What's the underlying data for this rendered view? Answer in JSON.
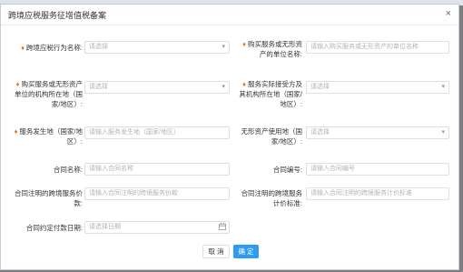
{
  "dialog": {
    "title": "跨境应税服务征增值税备案",
    "close_glyph": "×"
  },
  "fields": {
    "taxable_country": {
      "label": "跨境应税行为名称:",
      "placeholder": "请选择"
    },
    "purchaser_unit": {
      "label": "购买服务或无形资产的单位名称:",
      "placeholder": "请输入购买服务或无形资产的单位名称"
    },
    "purchaser_region": {
      "label": "购买服务或无形资产单位的机构所在地（国家/地区）:",
      "placeholder": "请选择"
    },
    "recipient_region": {
      "label": "服务实际接受方及其机构所在地（国家/地区）:",
      "placeholder": "请选择"
    },
    "service_location": {
      "label": "服务发生地（国家/地区）:",
      "placeholder": "请输入服务发生地（国家/地区）"
    },
    "intangible_location": {
      "label": "无形资产使用地（国家/地区）:",
      "placeholder": "请选择"
    },
    "contract_name": {
      "label": "合同名称:",
      "placeholder": "请输入合同名称"
    },
    "contract_number": {
      "label": "合同编号:",
      "placeholder": "请输入合同编号"
    },
    "contract_price": {
      "label": "合同注明的跨境服务价款:",
      "placeholder": "请输入合同注明的跨境服务价款"
    },
    "contract_price_std": {
      "label": "合同注明的跨境服务计价标准:",
      "placeholder": "请输入合同注明的跨境服务计价标准"
    },
    "payment_date": {
      "label": "合同约定付款日期:",
      "placeholder": "请选择日期"
    }
  },
  "buttons": {
    "cancel": "取 消",
    "confirm": "确 定"
  }
}
